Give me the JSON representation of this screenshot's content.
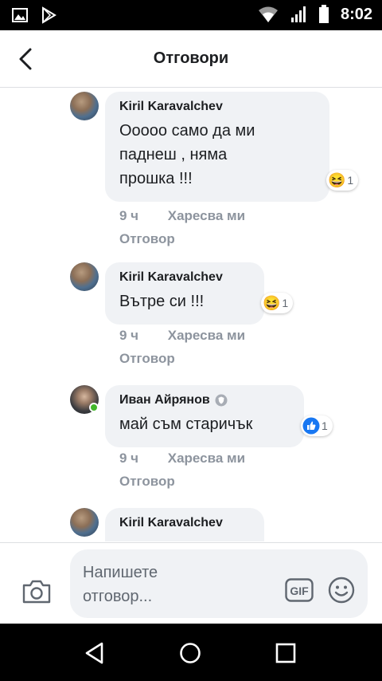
{
  "status_bar": {
    "time": "8:02"
  },
  "header": {
    "title": "Отговори"
  },
  "comments": [
    {
      "author": "Kiril Karavalchev",
      "text_lines": [
        "Ооооо само да ми",
        "паднеш , няма",
        "прошка !!!"
      ],
      "reaction_emoji": "😆",
      "reaction_count": "1",
      "time": "9 ч",
      "like_label": "Харесва ми",
      "reply_label": "Отговор"
    },
    {
      "author": "Kiril Karavalchev",
      "text_lines": [
        "Вътре си !!!"
      ],
      "reaction_emoji": "😆",
      "reaction_count": "1",
      "time": "9 ч",
      "like_label": "Харесва ми",
      "reply_label": "Отговор"
    },
    {
      "author": "Иван Айрянов",
      "text_lines": [
        "май съм старичък"
      ],
      "reaction_emoji": "👍",
      "reaction_count": "1",
      "time": "9 ч",
      "like_label": "Харесва ми",
      "reply_label": "Отговор"
    },
    {
      "author": "Kiril Karavalchev",
      "text_lines": []
    }
  ],
  "composer": {
    "placeholder_line1": "Напишете",
    "placeholder_line2": "отговор...",
    "gif_label": "GIF"
  },
  "icons": {
    "back": "back-arrow-icon",
    "camera": "camera-icon",
    "gif": "gif-icon",
    "emoji": "smiley-icon",
    "badge": "shield-badge-icon"
  },
  "colors": {
    "bubble": "#f0f2f5",
    "meta_text": "#8d949e",
    "like_blue": "#1877f2",
    "haha_yellow": "#f7b125",
    "online_green": "#42b72a"
  }
}
